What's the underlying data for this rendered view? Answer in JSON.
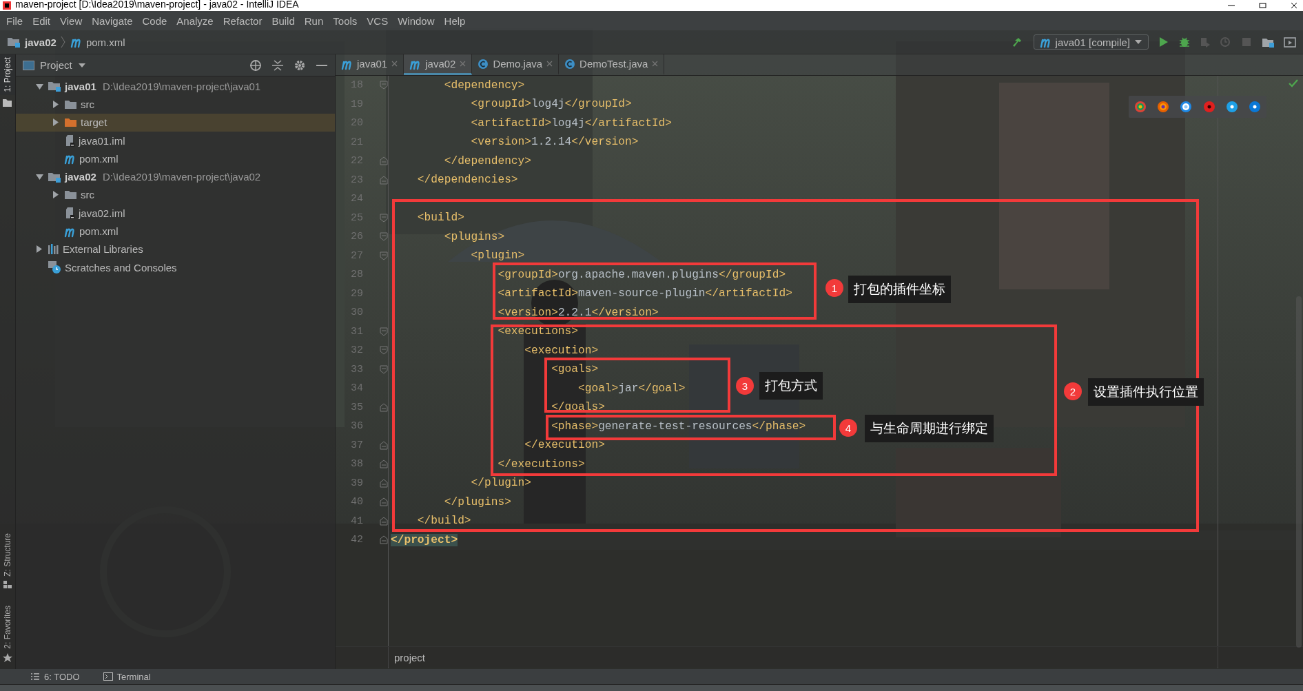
{
  "window": {
    "title": "maven-project [D:\\Idea2019\\maven-project] - java02 - IntelliJ IDEA"
  },
  "menu": [
    "File",
    "Edit",
    "View",
    "Navigate",
    "Code",
    "Analyze",
    "Refactor",
    "Build",
    "Run",
    "Tools",
    "VCS",
    "Window",
    "Help"
  ],
  "navigation": {
    "items": [
      {
        "kind": "module",
        "label": "java02"
      },
      {
        "kind": "maven",
        "label": "pom.xml"
      }
    ],
    "run_configuration": "java01 [compile]"
  },
  "tool_windows_left": [
    {
      "label": "1: Project",
      "selected": true
    },
    {
      "label": "Z: Structure",
      "selected": false
    },
    {
      "label": "2: Favorites",
      "selected": false
    }
  ],
  "project_panel": {
    "title": "Project",
    "tree": [
      {
        "kind": "module",
        "label": "java01",
        "detail": "D:\\Idea2019\\maven-project\\java01",
        "expanded": true,
        "selected": false,
        "children": [
          {
            "kind": "folder",
            "label": "src",
            "expanded": false,
            "selected": false
          },
          {
            "kind": "excluded",
            "label": "target",
            "expanded": false,
            "selected": true
          },
          {
            "kind": "iml",
            "label": "java01.iml",
            "selected": false
          },
          {
            "kind": "maven",
            "label": "pom.xml",
            "selected": false
          }
        ]
      },
      {
        "kind": "module",
        "label": "java02",
        "detail": "D:\\Idea2019\\maven-project\\java02",
        "expanded": true,
        "selected": false,
        "children": [
          {
            "kind": "folder",
            "label": "src",
            "expanded": false,
            "selected": false
          },
          {
            "kind": "iml",
            "label": "java02.iml",
            "selected": false
          },
          {
            "kind": "maven",
            "label": "pom.xml",
            "selected": false
          }
        ]
      },
      {
        "kind": "libraries",
        "label": "External Libraries",
        "expanded": false,
        "selected": false
      },
      {
        "kind": "scratches",
        "label": "Scratches and Consoles",
        "selected": false
      }
    ]
  },
  "editor_tabs": [
    {
      "kind": "maven",
      "label": "java01",
      "selected": false
    },
    {
      "kind": "maven",
      "label": "java02",
      "selected": true
    },
    {
      "kind": "class",
      "label": "Demo.java",
      "selected": false
    },
    {
      "kind": "class",
      "label": "DemoTest.java",
      "selected": false
    }
  ],
  "editor": {
    "lines": [
      {
        "number": "18",
        "code": "        <dependency>",
        "kind": "fold-start",
        "current": false
      },
      {
        "number": "19",
        "code": "            <groupId>log4j</groupId>",
        "current": false
      },
      {
        "number": "20",
        "code": "            <artifactId>log4j</artifactId>",
        "current": false
      },
      {
        "number": "21",
        "code": "            <version>1.2.14</version>",
        "current": false
      },
      {
        "number": "22",
        "code": "        </dependency>",
        "kind": "fold-end",
        "current": false
      },
      {
        "number": "23",
        "code": "    </dependencies>",
        "kind": "fold-end",
        "current": false
      },
      {
        "number": "24",
        "current": false
      },
      {
        "number": "25",
        "code": "    <build>",
        "kind": "fold-start",
        "current": false
      },
      {
        "number": "26",
        "code": "        <plugins>",
        "kind": "fold-start",
        "current": false
      },
      {
        "number": "27",
        "code": "            <plugin>",
        "kind": "fold-start",
        "current": false
      },
      {
        "number": "28",
        "code": "                <groupId>org.apache.maven.plugins</groupId>",
        "current": false
      },
      {
        "number": "29",
        "code": "                <artifactId>maven-source-plugin</artifactId>",
        "current": false
      },
      {
        "number": "30",
        "code": "                <version>2.2.1</version>",
        "current": false
      },
      {
        "number": "31",
        "code": "                <executions>",
        "kind": "fold-start",
        "current": false
      },
      {
        "number": "32",
        "code": "                    <execution>",
        "kind": "fold-start",
        "current": false
      },
      {
        "number": "33",
        "code": "                        <goals>",
        "kind": "fold-start",
        "current": false
      },
      {
        "number": "34",
        "code": "                            <goal>jar</goal>",
        "current": false
      },
      {
        "number": "35",
        "code": "                        </goals>",
        "kind": "fold-end",
        "current": false
      },
      {
        "number": "36",
        "code": "                        <phase>generate-test-resources</phase>",
        "current": false
      },
      {
        "number": "37",
        "code": "                    </execution>",
        "kind": "fold-end",
        "current": false
      },
      {
        "number": "38",
        "code": "                </executions>",
        "kind": "fold-end",
        "current": false
      },
      {
        "number": "39",
        "code": "            </plugin>",
        "kind": "fold-end",
        "current": false
      },
      {
        "number": "40",
        "code": "        </plugins>",
        "kind": "fold-end",
        "current": false
      },
      {
        "number": "41",
        "code": "    </build>",
        "kind": "fold-end",
        "current": false
      },
      {
        "number": "42",
        "code": "</project>",
        "kind": "fold-end",
        "current": true
      }
    ],
    "breadcrumb": "project"
  },
  "annotations": [
    {
      "number": "1",
      "label": "打包的插件坐标"
    },
    {
      "number": "2",
      "label": "设置插件执行位置"
    },
    {
      "number": "3",
      "label": "打包方式"
    },
    {
      "number": "4",
      "label": "与生命周期进行绑定"
    }
  ],
  "bottom_tools": [
    {
      "kind": "todo",
      "label": "6: TODO"
    },
    {
      "kind": "terminal",
      "label": "Terminal"
    }
  ]
}
